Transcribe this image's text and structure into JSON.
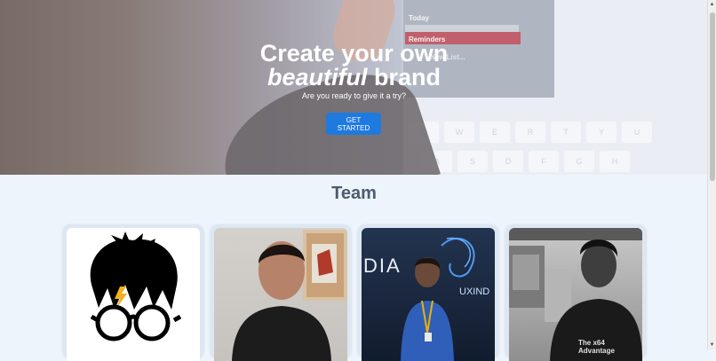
{
  "hero": {
    "title_line1": "Create your own",
    "title_italic": "beautiful",
    "title_rest": "brand",
    "subtitle": "Are you ready to give it a try?",
    "cta_label": "GET STARTED",
    "menu_today": "Today",
    "menu_reminders": "Reminders",
    "menu_newlist": "New List...",
    "keys": [
      "Q",
      "W",
      "E",
      "R",
      "T",
      "Y",
      "U",
      "A",
      "S",
      "D",
      "F",
      "G",
      "H"
    ]
  },
  "team": {
    "title": "Team",
    "members": [
      {
        "photo": "cartoon-avatar-icon"
      },
      {
        "photo": "person-photo"
      },
      {
        "photo": "person-photo",
        "banner_text": "DIA",
        "brand_text": "UXIND"
      },
      {
        "photo": "person-photo",
        "shirt_text": "The x64 Advantage"
      }
    ]
  },
  "colors": {
    "accent": "#1f7ae0",
    "heading": "#4d5b6f",
    "background": "#eef4fb"
  }
}
